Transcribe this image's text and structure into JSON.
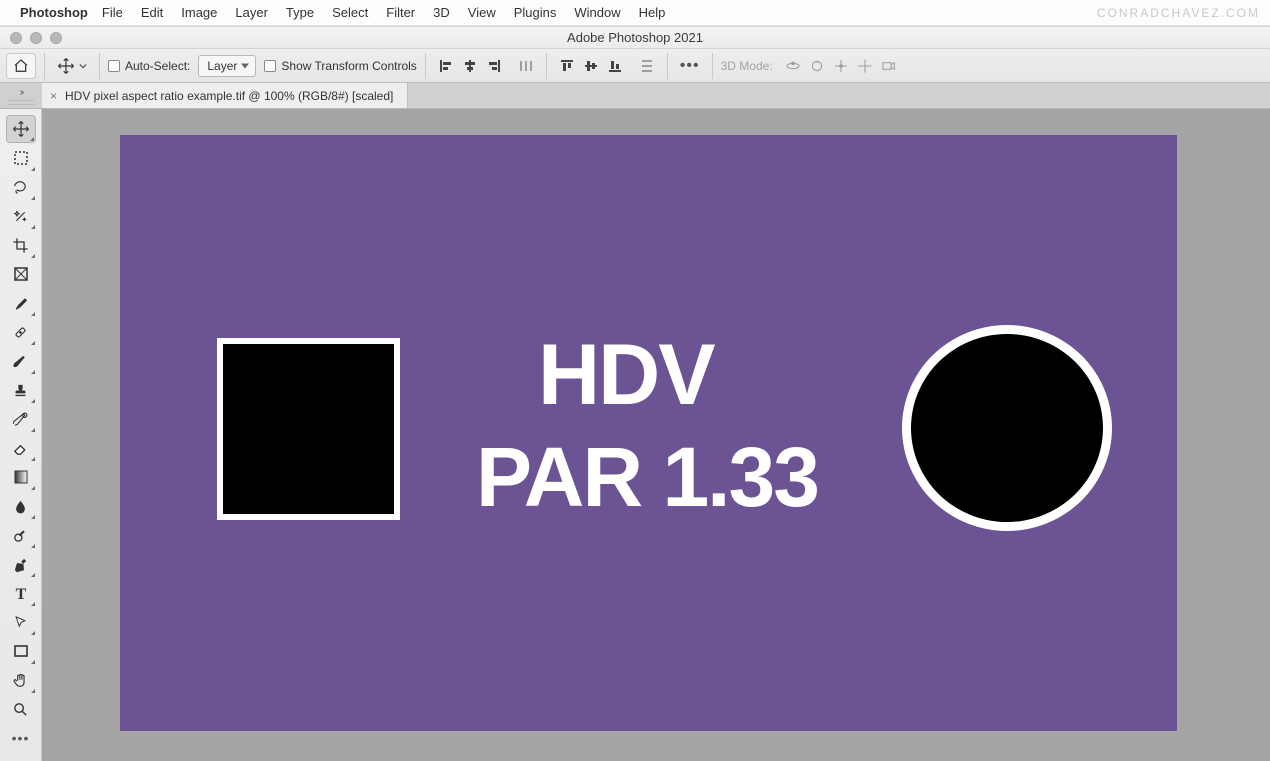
{
  "menubar": {
    "app": "Photoshop",
    "items": [
      "File",
      "Edit",
      "Image",
      "Layer",
      "Type",
      "Select",
      "Filter",
      "3D",
      "View",
      "Plugins",
      "Window",
      "Help"
    ],
    "watermark": "CONRADCHAVEZ.COM"
  },
  "window": {
    "title": "Adobe Photoshop 2021"
  },
  "options": {
    "auto_select_label": "Auto-Select:",
    "auto_select_target": "Layer",
    "show_transform_label": "Show Transform Controls",
    "mode3d_label": "3D Mode:"
  },
  "tabs": {
    "active": "HDV pixel aspect ratio example.tif @ 100% (RGB/8#) [scaled]"
  },
  "canvas": {
    "bg": "#6c5494",
    "text_line1": "HDV",
    "text_line2": "PAR 1.33"
  },
  "tools": [
    "move",
    "marquee",
    "lasso",
    "magic-wand",
    "crop",
    "frame",
    "eyedropper",
    "ruler",
    "brush",
    "stamp",
    "history-brush",
    "eraser",
    "gradient",
    "blur",
    "dodge",
    "pen",
    "type",
    "path-select",
    "rectangle",
    "hand",
    "zoom",
    "more"
  ]
}
